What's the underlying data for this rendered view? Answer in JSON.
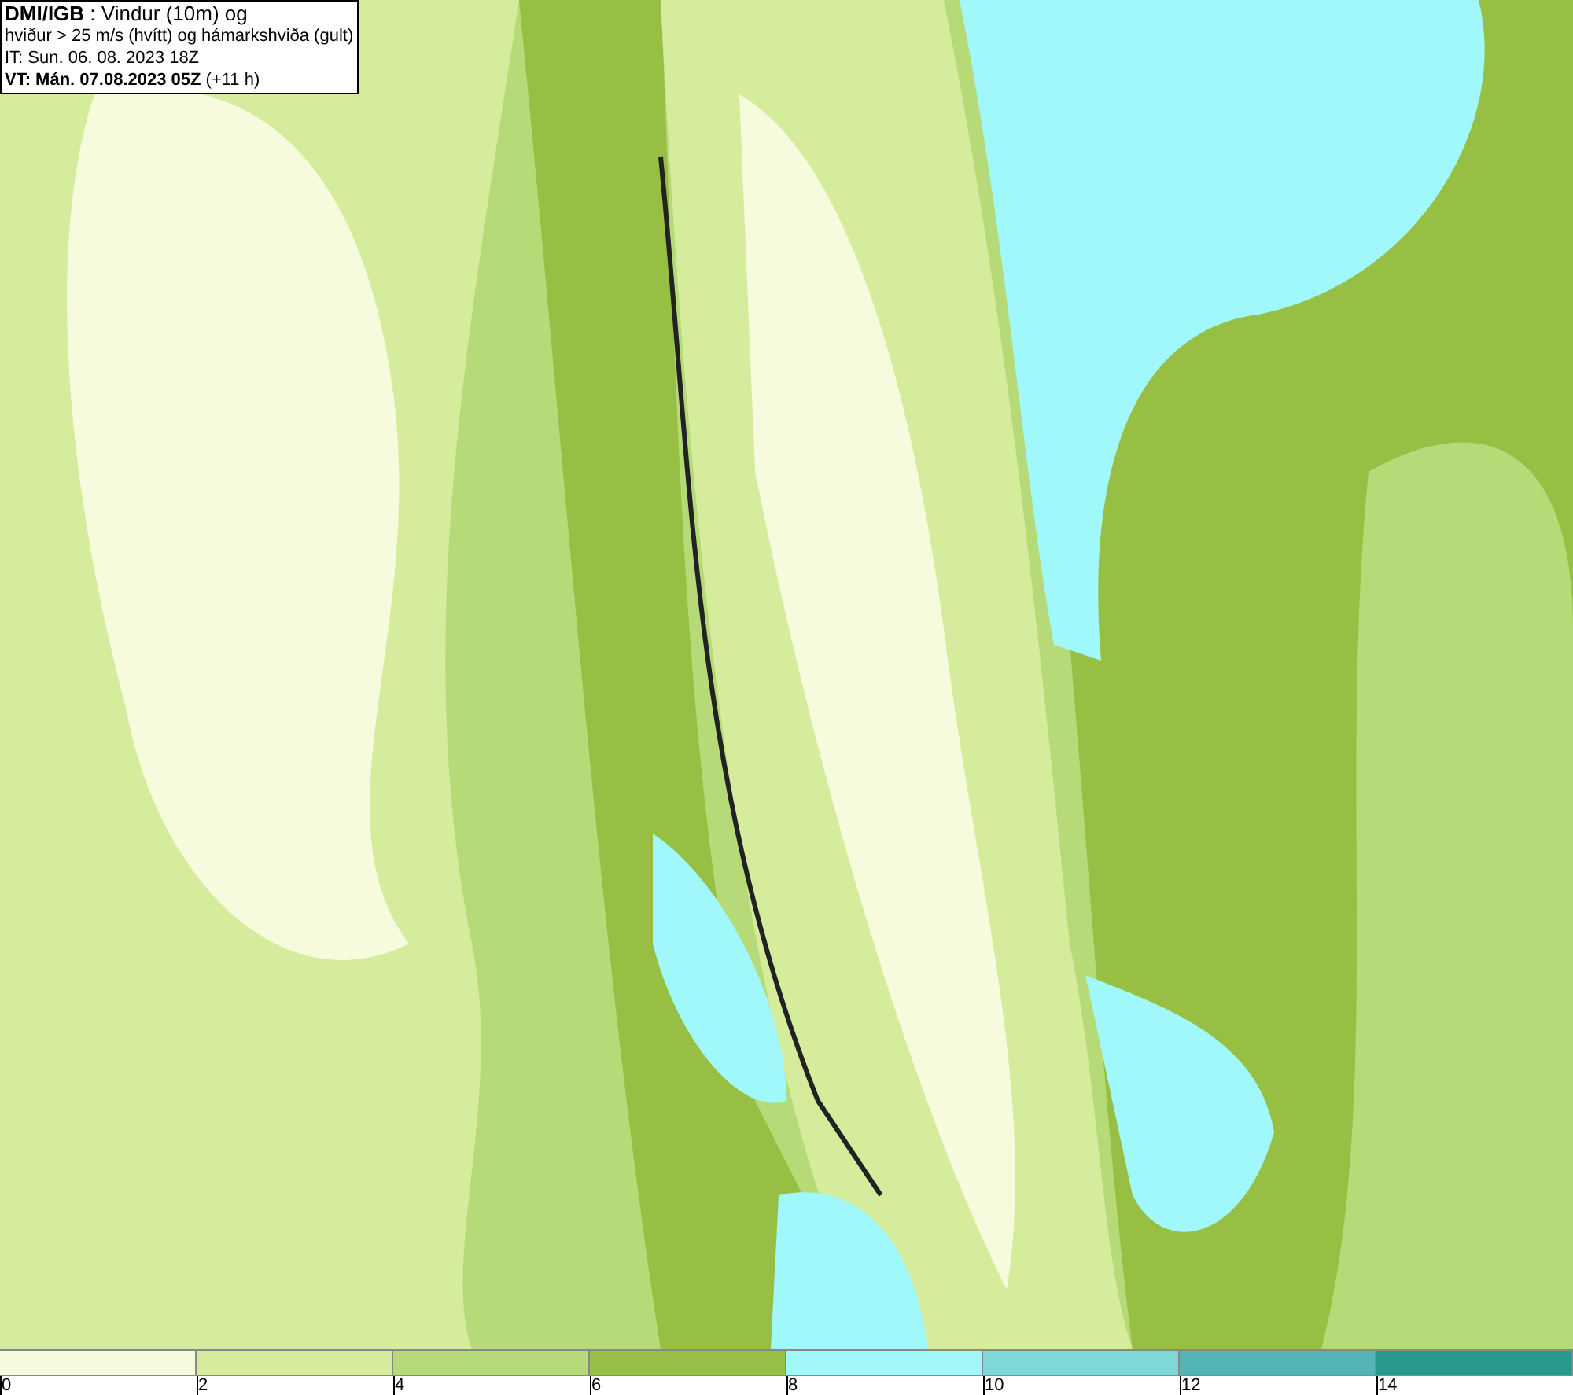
{
  "header": {
    "lines": [
      "**DMI/IGB** : Vindur (10m) og",
      "hviður > 25 m/s (hvítt) og hámarkshviða (gult)",
      "IT: Sun. 06. 08. 2023 18Z",
      "**VT: Mán. 07.08.2023 05Z** (+11 h)"
    ]
  },
  "legend": {
    "bins": [
      {
        "label": "0",
        "color": "#f5fbdc"
      },
      {
        "label": "2",
        "color": "#d4ec9c"
      },
      {
        "label": "4",
        "color": "#b7da78"
      },
      {
        "label": "6",
        "color": "#96bf44"
      },
      {
        "label": "8",
        "color": "#a0f8fa"
      },
      {
        "label": "10",
        "color": "#7fd8d8"
      },
      {
        "label": "12",
        "color": "#52b4b4"
      },
      {
        "label": "14",
        "color": "#279a90"
      }
    ]
  }
}
